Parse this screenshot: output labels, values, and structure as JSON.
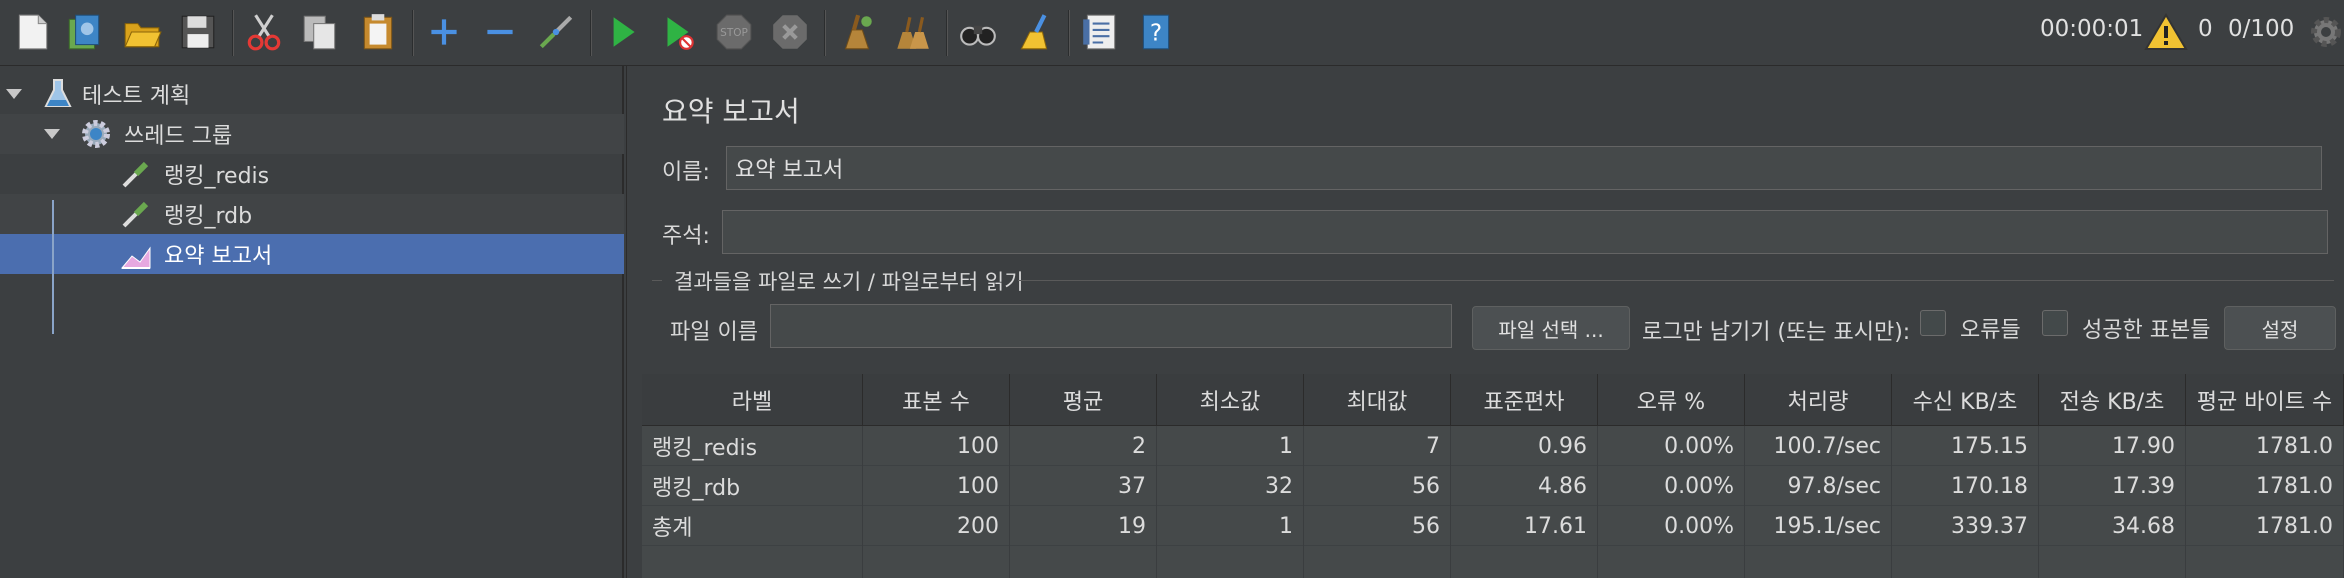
{
  "toolbar": {
    "icons": [
      "new-icon",
      "templates-icon",
      "open-icon",
      "save-icon",
      "cut-icon",
      "copy-icon",
      "paste-icon",
      "expand-icon",
      "collapse-icon",
      "toggle-icon",
      "start-icon",
      "start-no-pause-icon",
      "stop-icon",
      "shutdown-icon",
      "clear-icon",
      "clear-all-icon",
      "search-icon",
      "reset-search-icon",
      "function-helper-icon",
      "help-icon"
    ],
    "timer": "00:00:01",
    "warning_count": "0",
    "thread_count": "0/100"
  },
  "tree": {
    "items": [
      {
        "label": "테스트 계획",
        "icon": "flask-icon"
      },
      {
        "label": "쓰레드 그룹",
        "icon": "gear-icon"
      },
      {
        "label": "랭킹_redis",
        "icon": "pipette-icon"
      },
      {
        "label": "랭킹_rdb",
        "icon": "pipette-icon"
      },
      {
        "label": "요약 보고서",
        "icon": "report-icon"
      }
    ]
  },
  "panel": {
    "title": "요약 보고서",
    "name_label": "이름:",
    "name_value": "요약 보고서",
    "comment_label": "주석:",
    "comment_value": "",
    "group_title": "결과들을 파일로 쓰기 / 파일로부터 읽기",
    "filename_label": "파일 이름",
    "filename_value": "",
    "browse_button": "파일 선택 ...",
    "log_only_label": "로그만 남기기 (또는 표시만):",
    "errors_label": "오류들",
    "success_label": "성공한 표본들",
    "configure_button": "설정"
  },
  "table": {
    "headers": [
      "라벨",
      "표본 수",
      "평균",
      "최소값",
      "최대값",
      "표준편차",
      "오류 %",
      "처리량",
      "수신 KB/초",
      "전송 KB/초",
      "평균 바이트 수"
    ],
    "rows": [
      [
        "랭킹_redis",
        "100",
        "2",
        "1",
        "7",
        "0.96",
        "0.00%",
        "100.7/sec",
        "175.15",
        "17.90",
        "1781.0"
      ],
      [
        "랭킹_rdb",
        "100",
        "37",
        "32",
        "56",
        "4.86",
        "0.00%",
        "97.8/sec",
        "170.18",
        "17.39",
        "1781.0"
      ],
      [
        "총계",
        "200",
        "19",
        "1",
        "56",
        "17.61",
        "0.00%",
        "195.1/sec",
        "339.37",
        "34.68",
        "1781.0"
      ]
    ]
  }
}
